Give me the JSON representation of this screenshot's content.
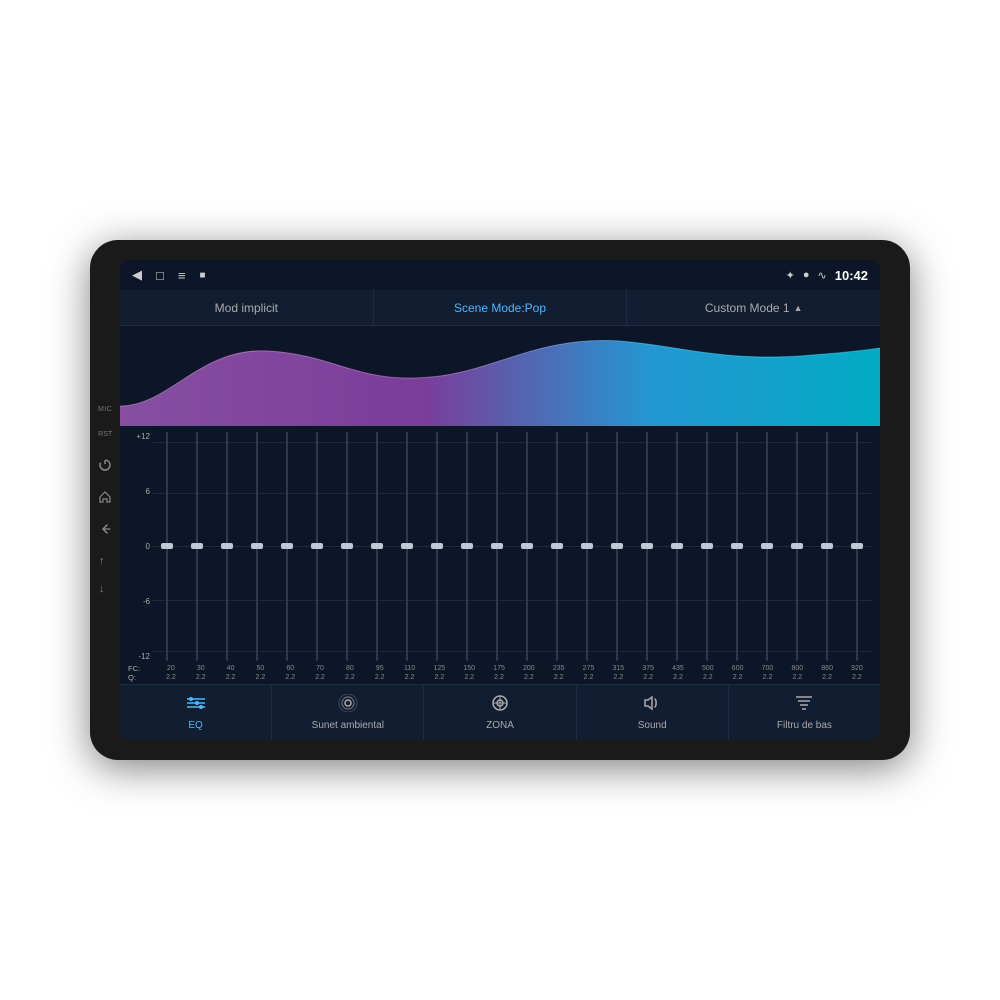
{
  "device": {
    "background": "#1a1a1a"
  },
  "status_bar": {
    "time": "10:42",
    "mic_label": "MIC",
    "rst_label": "RST"
  },
  "tabs": {
    "items": [
      {
        "id": "mod_implicit",
        "label": "Mod implicit",
        "active": false
      },
      {
        "id": "scene_mode",
        "label": "Scene Mode:Pop",
        "active": true
      },
      {
        "id": "custom_mode",
        "label": "Custom Mode 1",
        "active": false
      }
    ]
  },
  "eq_bands": [
    {
      "freq": "20",
      "q": "2.2",
      "value": 0
    },
    {
      "freq": "30",
      "q": "2.2",
      "value": 0
    },
    {
      "freq": "40",
      "q": "2.2",
      "value": 0
    },
    {
      "freq": "50",
      "q": "2.2",
      "value": 0
    },
    {
      "freq": "60",
      "q": "2.2",
      "value": 0
    },
    {
      "freq": "70",
      "q": "2.2",
      "value": 0
    },
    {
      "freq": "80",
      "q": "2.2",
      "value": 0
    },
    {
      "freq": "95",
      "q": "2.2",
      "value": 0
    },
    {
      "freq": "110",
      "q": "2.2",
      "value": 0
    },
    {
      "freq": "125",
      "q": "2.2",
      "value": 0
    },
    {
      "freq": "150",
      "q": "2.2",
      "value": 0
    },
    {
      "freq": "175",
      "q": "2.2",
      "value": 0
    },
    {
      "freq": "200",
      "q": "2.2",
      "value": 0
    },
    {
      "freq": "235",
      "q": "2.2",
      "value": 0
    },
    {
      "freq": "275",
      "q": "2.2",
      "value": 0
    },
    {
      "freq": "315",
      "q": "2.2",
      "value": 0
    },
    {
      "freq": "375",
      "q": "2.2",
      "value": 0
    },
    {
      "freq": "435",
      "q": "2.2",
      "value": 0
    },
    {
      "freq": "500",
      "q": "2.2",
      "value": 0
    },
    {
      "freq": "600",
      "q": "2.2",
      "value": 0
    },
    {
      "freq": "700",
      "q": "2.2",
      "value": 0
    },
    {
      "freq": "800",
      "q": "2.2",
      "value": 0
    },
    {
      "freq": "860",
      "q": "2.2",
      "value": 0
    },
    {
      "freq": "920",
      "q": "2.2",
      "value": 0
    }
  ],
  "grid_labels": [
    "+12",
    "6",
    "0",
    "-6",
    "-12"
  ],
  "bottom_nav": {
    "items": [
      {
        "id": "eq",
        "label": "EQ",
        "icon": "sliders",
        "active": true
      },
      {
        "id": "ambient",
        "label": "Sunet ambiental",
        "icon": "radio",
        "active": false
      },
      {
        "id": "zona",
        "label": "ZONA",
        "icon": "target",
        "active": false
      },
      {
        "id": "sound",
        "label": "Sound",
        "icon": "volume",
        "active": false
      },
      {
        "id": "filtru",
        "label": "Filtru de bas",
        "icon": "filter",
        "active": false
      }
    ]
  }
}
